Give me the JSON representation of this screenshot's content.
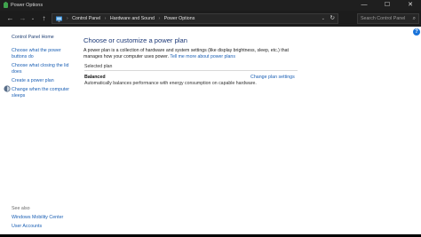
{
  "window": {
    "title": "Power Options",
    "minimize_glyph": "—",
    "maximize_glyph": "☐",
    "close_glyph": "✕"
  },
  "nav": {
    "back_glyph": "←",
    "forward_glyph": "→",
    "recent_glyph": "⌄",
    "up_glyph": "↑"
  },
  "address": {
    "breadcrumbs": [
      "Control Panel",
      "Hardware and Sound",
      "Power Options"
    ],
    "separator": "›",
    "dropdown_glyph": "⌄",
    "refresh_glyph": "↻"
  },
  "search": {
    "placeholder": "Search Control Panel",
    "icon_glyph": "⌕"
  },
  "help": {
    "glyph": "?"
  },
  "sidebar": {
    "home": "Control Panel Home",
    "links": [
      "Choose what the power buttons do",
      "Choose what closing the lid does",
      "Create a power plan",
      "Change when the computer sleeps"
    ],
    "see_also_label": "See also",
    "see_also": [
      "Windows Mobility Center",
      "User Accounts"
    ]
  },
  "main": {
    "heading": "Choose or customize a power plan",
    "description": "A power plan is a collection of hardware and system settings (like display brightness, sleep, etc.) that manages how your computer uses power.",
    "description_link": "Tell me more about power plans",
    "selected_plan_label": "Selected plan",
    "plan": {
      "name": "Balanced",
      "change_link": "Change plan settings",
      "description": "Automatically balances performance with energy consumption on capable hardware."
    }
  },
  "colors": {
    "titlebar": "#1f1f1f",
    "link": "#1a5fb4",
    "heading": "#1e3a78",
    "help_badge": "#1a73d9"
  }
}
